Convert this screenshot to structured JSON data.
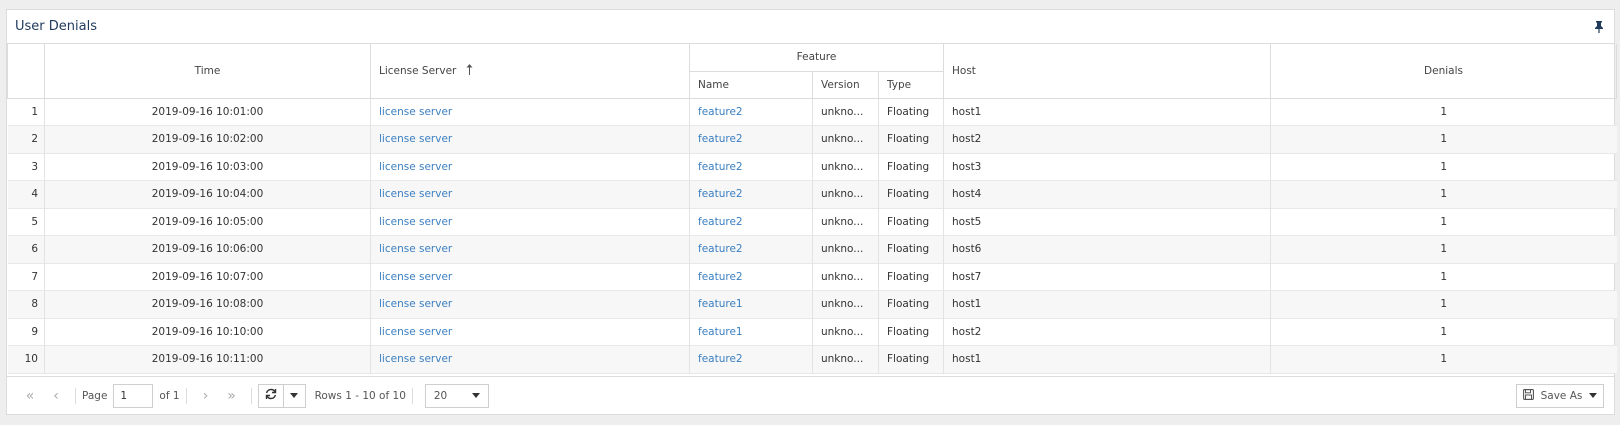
{
  "panel": {
    "title": "User Denials"
  },
  "columns": {
    "time": "Time",
    "license_server": "License Server",
    "feature_group": "Feature",
    "name": "Name",
    "version": "Version",
    "type": "Type",
    "host": "Host",
    "denials": "Denials"
  },
  "rows": [
    {
      "n": "1",
      "time": "2019-09-16 10:01:00",
      "server": "license server",
      "feature": "feature2",
      "version": "unkno...",
      "type": "Floating",
      "host": "host1",
      "denials": "1"
    },
    {
      "n": "2",
      "time": "2019-09-16 10:02:00",
      "server": "license server",
      "feature": "feature2",
      "version": "unkno...",
      "type": "Floating",
      "host": "host2",
      "denials": "1"
    },
    {
      "n": "3",
      "time": "2019-09-16 10:03:00",
      "server": "license server",
      "feature": "feature2",
      "version": "unkno...",
      "type": "Floating",
      "host": "host3",
      "denials": "1"
    },
    {
      "n": "4",
      "time": "2019-09-16 10:04:00",
      "server": "license server",
      "feature": "feature2",
      "version": "unkno...",
      "type": "Floating",
      "host": "host4",
      "denials": "1"
    },
    {
      "n": "5",
      "time": "2019-09-16 10:05:00",
      "server": "license server",
      "feature": "feature2",
      "version": "unkno...",
      "type": "Floating",
      "host": "host5",
      "denials": "1"
    },
    {
      "n": "6",
      "time": "2019-09-16 10:06:00",
      "server": "license server",
      "feature": "feature2",
      "version": "unkno...",
      "type": "Floating",
      "host": "host6",
      "denials": "1"
    },
    {
      "n": "7",
      "time": "2019-09-16 10:07:00",
      "server": "license server",
      "feature": "feature2",
      "version": "unkno...",
      "type": "Floating",
      "host": "host7",
      "denials": "1"
    },
    {
      "n": "8",
      "time": "2019-09-16 10:08:00",
      "server": "license server",
      "feature": "feature1",
      "version": "unkno...",
      "type": "Floating",
      "host": "host1",
      "denials": "1"
    },
    {
      "n": "9",
      "time": "2019-09-16 10:10:00",
      "server": "license server",
      "feature": "feature1",
      "version": "unkno...",
      "type": "Floating",
      "host": "host2",
      "denials": "1"
    },
    {
      "n": "10",
      "time": "2019-09-16 10:11:00",
      "server": "license server",
      "feature": "feature2",
      "version": "unkno...",
      "type": "Floating",
      "host": "host1",
      "denials": "1"
    }
  ],
  "pager": {
    "page_label": "Page",
    "page_value": "1",
    "of_label": "of 1",
    "rows_info": "Rows 1 - 10 of 10",
    "page_size": "20",
    "save_as": "Save As"
  },
  "icons": {
    "pin": "pin-icon",
    "first": "first-page-icon",
    "prev": "prev-page-icon",
    "next": "next-page-icon",
    "last": "last-page-icon",
    "refresh": "refresh-icon",
    "save": "floppy-disk-icon",
    "sort": "sort-ascending-icon"
  },
  "colors": {
    "link": "#3a7fc1",
    "title": "#1f3a5c"
  }
}
